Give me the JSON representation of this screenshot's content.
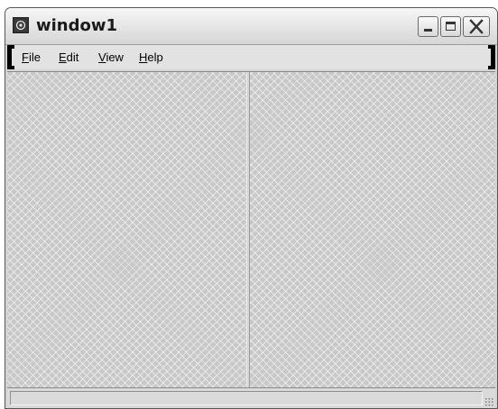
{
  "window": {
    "title": "window1",
    "icon": "app-window-icon"
  },
  "titlebar_buttons": {
    "minimize": "minimize-icon",
    "maximize": "maximize-icon",
    "close": "close-icon"
  },
  "menubar": {
    "items": [
      {
        "label": "File",
        "accel": "F"
      },
      {
        "label": "Edit",
        "accel": "E"
      },
      {
        "label": "View",
        "accel": "V"
      },
      {
        "label": "Help",
        "accel": "H"
      }
    ]
  },
  "statusbar": {
    "text": ""
  },
  "colors": {
    "content_background": "#c8c8c8",
    "menubar_background": "#e2e2e2"
  }
}
